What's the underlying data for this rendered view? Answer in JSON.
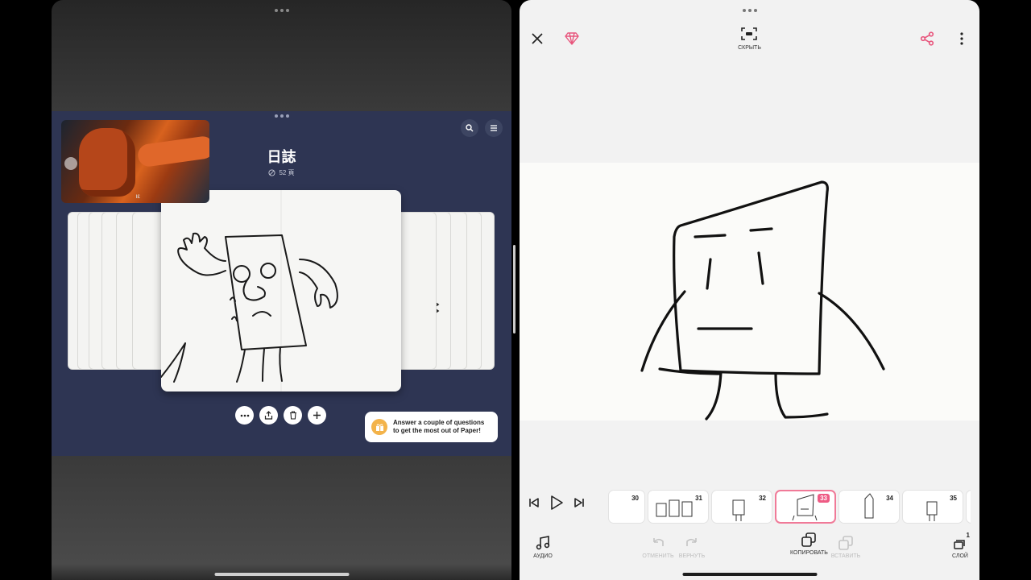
{
  "left_app": {
    "window_dots": "•••",
    "book": {
      "title": "日誌",
      "pages": "52 頁"
    },
    "toast": {
      "line1": "Answer a couple of questions",
      "line2": "to get the most out of Paper!"
    }
  },
  "right_app": {
    "toolbar": {
      "hide_label": "СКРЫТЬ"
    },
    "timeline": {
      "frames": [
        {
          "number": "30",
          "active": false
        },
        {
          "number": "31",
          "active": false
        },
        {
          "number": "32",
          "active": false
        },
        {
          "number": "33",
          "active": true
        },
        {
          "number": "34",
          "active": false
        },
        {
          "number": "35",
          "active": false
        }
      ]
    },
    "bottom_tools": {
      "audio": "АУДИО",
      "undo": "ОТМЕНИТЬ",
      "redo": "ВЕРНУТЬ",
      "copy": "КОПИРОВАТЬ",
      "paste": "ВСТАВИТЬ",
      "layer": "СЛОЙ",
      "layer_count": "1"
    }
  },
  "colors": {
    "accent_pink": "#ee5b84",
    "book_bg": "#2e3553",
    "diamond": "#e8557c"
  }
}
